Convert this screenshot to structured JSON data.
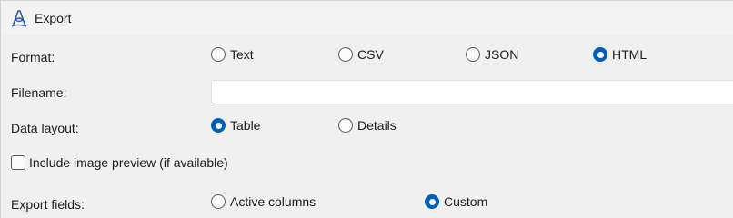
{
  "window": {
    "title": "Export",
    "icon": "app-script-a-icon"
  },
  "format": {
    "label": "Format:",
    "options": [
      {
        "label": "Text",
        "checked": false
      },
      {
        "label": "CSV",
        "checked": false
      },
      {
        "label": "JSON",
        "checked": false
      },
      {
        "label": "HTML",
        "checked": true
      }
    ]
  },
  "filename": {
    "label": "Filename:",
    "value": "",
    "placeholder": ""
  },
  "data_layout": {
    "label": "Data layout:",
    "options": [
      {
        "label": "Table",
        "checked": true
      },
      {
        "label": "Details",
        "checked": false
      }
    ]
  },
  "image_preview": {
    "label": "Include image preview (if available)",
    "checked": false
  },
  "export_fields": {
    "label": "Export fields:",
    "options": [
      {
        "label": "Active columns",
        "checked": false
      },
      {
        "label": "Custom",
        "checked": true
      }
    ]
  },
  "colors": {
    "accent": "#005fb8",
    "background": "#f0f0f0"
  }
}
